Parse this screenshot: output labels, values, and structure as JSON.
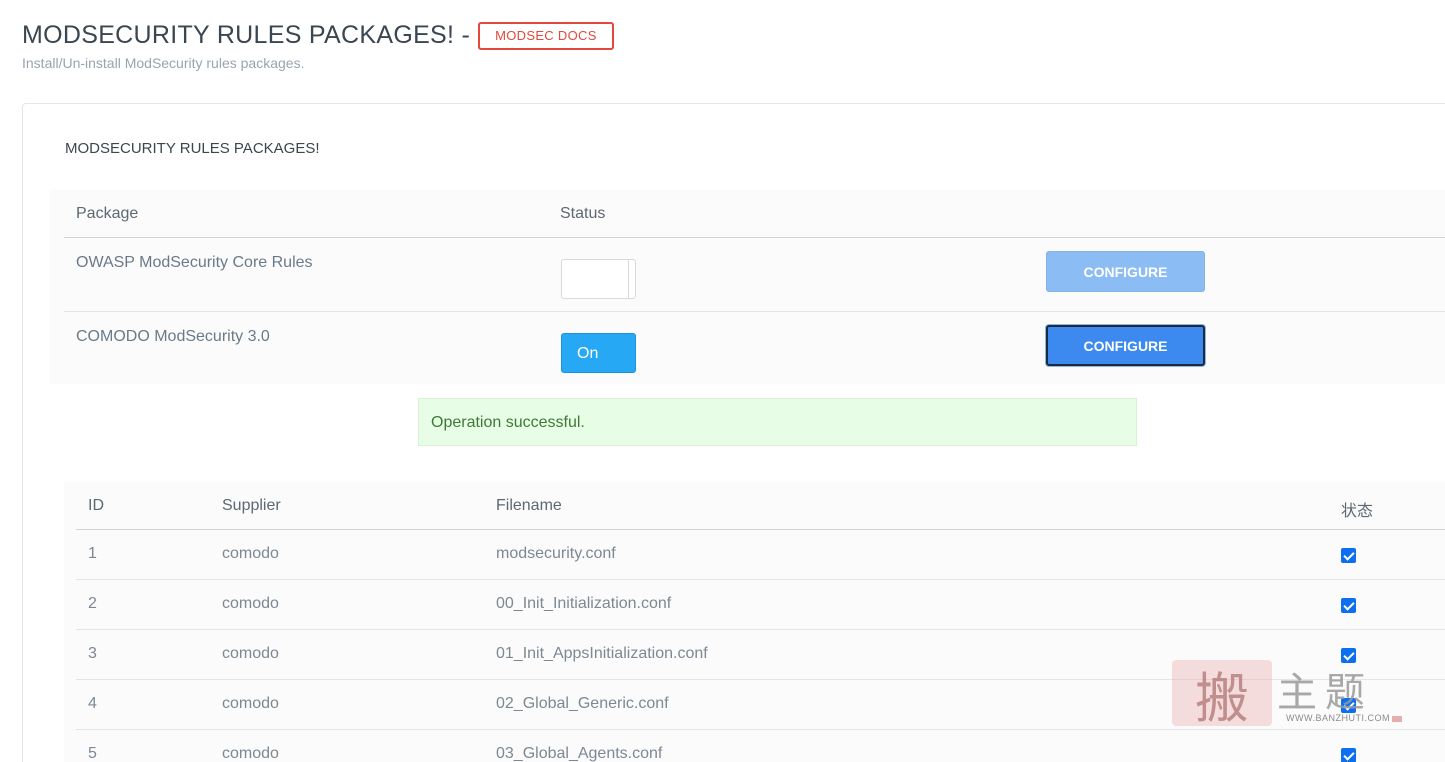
{
  "header": {
    "title": "MODSECURITY RULES PACKAGES! -",
    "docs_label": "MODSEC DOCS",
    "subtitle": "Install/Un-install ModSecurity rules packages."
  },
  "card": {
    "title": "MODSECURITY RULES PACKAGES!"
  },
  "packages": {
    "columns": [
      "Package",
      "Status"
    ],
    "rows": [
      {
        "name": "OWASP ModSecurity Core Rules",
        "status": "",
        "configure_label": "CONFIGURE"
      },
      {
        "name": "COMODO ModSecurity 3.0",
        "status": "On",
        "configure_label": "CONFIGURE"
      }
    ]
  },
  "alert": {
    "message": "Operation successful."
  },
  "rules": {
    "columns": [
      "ID",
      "Supplier",
      "Filename",
      "状态"
    ],
    "rows": [
      {
        "id": "1",
        "supplier": "comodo",
        "filename": "modsecurity.conf",
        "checked": true
      },
      {
        "id": "2",
        "supplier": "comodo",
        "filename": "00_Init_Initialization.conf",
        "checked": true
      },
      {
        "id": "3",
        "supplier": "comodo",
        "filename": "01_Init_AppsInitialization.conf",
        "checked": true
      },
      {
        "id": "4",
        "supplier": "comodo",
        "filename": "02_Global_Generic.conf",
        "checked": true
      },
      {
        "id": "5",
        "supplier": "comodo",
        "filename": "03_Global_Agents.conf",
        "checked": true
      }
    ]
  },
  "watermark": {
    "seal_char": "搬",
    "text": "主题",
    "url": "WWW.BANZHUTI.COM"
  },
  "colors": {
    "accent_red": "#e2483d",
    "toggle_on": "#26a8f5",
    "button_blue": "#3c8af0",
    "success_bg": "#e8fde6"
  }
}
